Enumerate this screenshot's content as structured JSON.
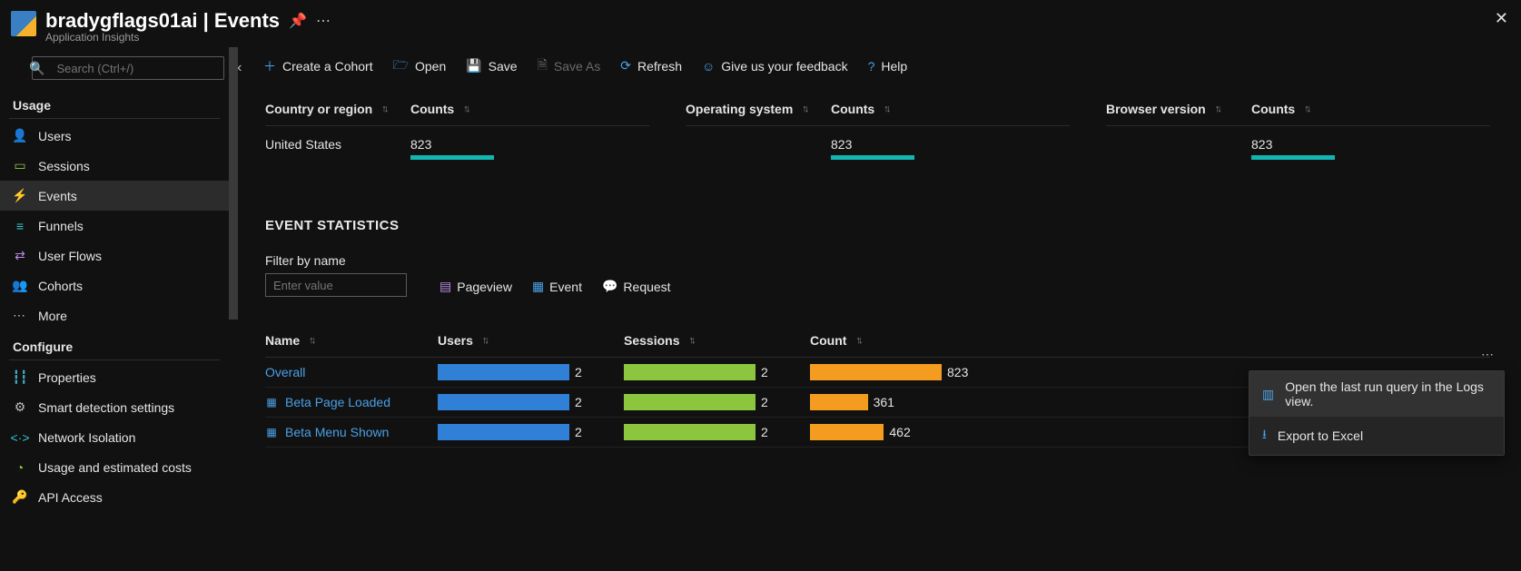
{
  "header": {
    "title": "bradygflags01ai | Events",
    "subtitle": "Application Insights"
  },
  "sidebar": {
    "search_placeholder": "Search (Ctrl+/)",
    "sections": {
      "usage": "Usage",
      "configure": "Configure"
    },
    "usage_items": [
      {
        "label": "Users",
        "icon": "users-icon",
        "color": "c-blue"
      },
      {
        "label": "Sessions",
        "icon": "sessions-icon",
        "color": "c-green"
      },
      {
        "label": "Events",
        "icon": "events-icon",
        "color": "c-yellow",
        "active": true
      },
      {
        "label": "Funnels",
        "icon": "funnels-icon",
        "color": "c-teal"
      },
      {
        "label": "User Flows",
        "icon": "userflows-icon",
        "color": "c-purple"
      },
      {
        "label": "Cohorts",
        "icon": "cohorts-icon",
        "color": "c-purple"
      },
      {
        "label": "More",
        "icon": "more-icon",
        "color": "c-grey"
      }
    ],
    "configure_items": [
      {
        "label": "Properties",
        "icon": "properties-icon",
        "color": "c-cyan"
      },
      {
        "label": "Smart detection settings",
        "icon": "smartdetect-icon",
        "color": "c-grey"
      },
      {
        "label": "Network Isolation",
        "icon": "network-icon",
        "color": "c-teal"
      },
      {
        "label": "Usage and estimated costs",
        "icon": "costs-icon",
        "color": "c-green"
      },
      {
        "label": "API Access",
        "icon": "apiaccess-icon",
        "color": "c-yellow"
      }
    ]
  },
  "toolbar": {
    "create": "Create a Cohort",
    "open": "Open",
    "save": "Save",
    "save_as": "Save As",
    "refresh": "Refresh",
    "feedback": "Give us your feedback",
    "help": "Help"
  },
  "summary_cards": [
    {
      "dim_label": "Country or region",
      "counts_label": "Counts",
      "row_label": "United States",
      "row_value": "823"
    },
    {
      "dim_label": "Operating system",
      "counts_label": "Counts",
      "row_label": "<undefined>",
      "row_value": "823"
    },
    {
      "dim_label": "Browser version",
      "counts_label": "Counts",
      "row_label": "<undefined>",
      "row_value": "823"
    }
  ],
  "event_stats": {
    "heading": "EVENT STATISTICS",
    "filter_label": "Filter by name",
    "filter_placeholder": "Enter value",
    "legend": {
      "pageview": "Pageview",
      "event": "Event",
      "request": "Request"
    },
    "columns": {
      "name": "Name",
      "users": "Users",
      "sessions": "Sessions",
      "count": "Count"
    },
    "rows": [
      {
        "name": "Overall",
        "is_event": false,
        "users": 2,
        "users_frac": 1.0,
        "sessions": 2,
        "sessions_frac": 1.0,
        "count": 823,
        "count_frac": 1.0
      },
      {
        "name": "Beta Page Loaded",
        "is_event": true,
        "users": 2,
        "users_frac": 1.0,
        "sessions": 2,
        "sessions_frac": 1.0,
        "count": 361,
        "count_frac": 0.44
      },
      {
        "name": "Beta Menu Shown",
        "is_event": true,
        "users": 2,
        "users_frac": 1.0,
        "sessions": 2,
        "sessions_frac": 1.0,
        "count": 462,
        "count_frac": 0.56
      }
    ]
  },
  "context_menu": {
    "open_logs": "Open the last run query in the Logs view.",
    "export": "Export to Excel"
  },
  "chart_data": {
    "type": "table",
    "summary": [
      {
        "dimension": "Country or region",
        "category": "United States",
        "counts": 823
      },
      {
        "dimension": "Operating system",
        "category": "<undefined>",
        "counts": 823
      },
      {
        "dimension": "Browser version",
        "category": "<undefined>",
        "counts": 823
      }
    ],
    "event_statistics": {
      "columns": [
        "Name",
        "Users",
        "Sessions",
        "Count"
      ],
      "rows": [
        {
          "Name": "Overall",
          "Users": 2,
          "Sessions": 2,
          "Count": 823
        },
        {
          "Name": "Beta Page Loaded",
          "Users": 2,
          "Sessions": 2,
          "Count": 361
        },
        {
          "Name": "Beta Menu Shown",
          "Users": 2,
          "Sessions": 2,
          "Count": 462
        }
      ],
      "max": {
        "Users": 2,
        "Sessions": 2,
        "Count": 823
      }
    }
  }
}
